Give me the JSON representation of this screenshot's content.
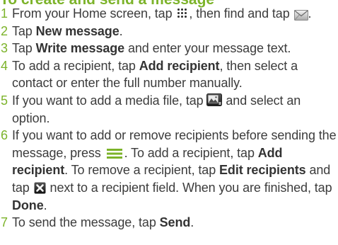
{
  "heading": "To create and send a message",
  "steps": [
    {
      "num": "1",
      "t1": "From your Home screen, tap",
      "t2": ", then find and tap",
      "t3": "."
    },
    {
      "num": "2",
      "t1": "Tap",
      "b1": "New message",
      "t2": "."
    },
    {
      "num": "3",
      "t1": "Tap",
      "b1": "Write message",
      "t2": "and enter your message text."
    },
    {
      "num": "4",
      "t1": "To add a recipient, tap",
      "b1": "Add recipient",
      "t2": ", then select a contact or enter the full number manually."
    },
    {
      "num": "5",
      "t1": "If you want to add a media file, tap",
      "t2": "and select an option."
    },
    {
      "num": "6",
      "t1": "If you want to add or remove recipients before sending the message, press",
      "t2": ". To add a recipient, tap",
      "b1": "Add recipient",
      "t3": ". To remove a recipient, tap",
      "b2": "Edit recipients",
      "t4": "and tap",
      "t5": "next to a recipient field. When you are finished, tap",
      "b3": "Done",
      "t6": "."
    },
    {
      "num": "7",
      "t1": "To send the message, tap",
      "b1": "Send",
      "t2": "."
    }
  ],
  "icons": {
    "apps": "apps-grid-icon",
    "messaging": "envelope-icon",
    "media": "media-attachment-icon",
    "menu": "menu-key-icon",
    "remove": "remove-recipient-icon"
  },
  "colors": {
    "accent": "#7cb32a",
    "text": "#3c3c3c"
  }
}
